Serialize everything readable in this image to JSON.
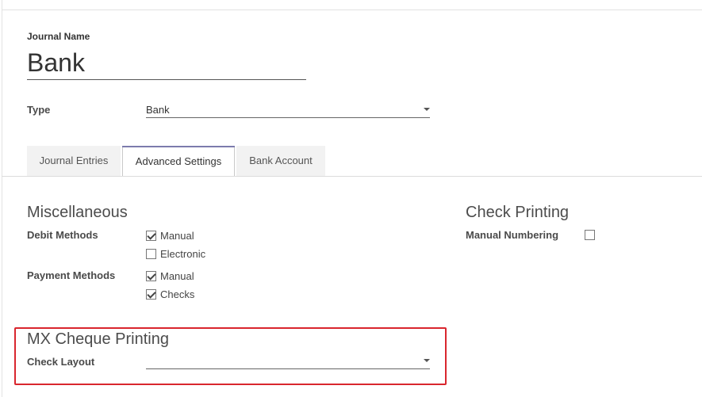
{
  "journal": {
    "name_label": "Journal Name",
    "name_value": "Bank"
  },
  "type_field": {
    "label": "Type",
    "value": "Bank"
  },
  "tabs": [
    {
      "label": "Journal Entries",
      "active": false
    },
    {
      "label": "Advanced Settings",
      "active": true
    },
    {
      "label": "Bank Account",
      "active": false
    }
  ],
  "misc": {
    "title": "Miscellaneous",
    "debit_label": "Debit Methods",
    "debit_options": [
      {
        "label": "Manual",
        "checked": true
      },
      {
        "label": "Electronic",
        "checked": false
      }
    ],
    "payment_label": "Payment Methods",
    "payment_options": [
      {
        "label": "Manual",
        "checked": true
      },
      {
        "label": "Checks",
        "checked": true
      }
    ]
  },
  "check_printing": {
    "title": "Check Printing",
    "manual_numbering_label": "Manual Numbering",
    "manual_numbering_checked": false
  },
  "mx_cheque": {
    "title": "MX Cheque Printing",
    "layout_label": "Check Layout",
    "layout_value": ""
  },
  "colors": {
    "tab_accent": "#7c7bad",
    "highlight_border": "#d9262e"
  }
}
